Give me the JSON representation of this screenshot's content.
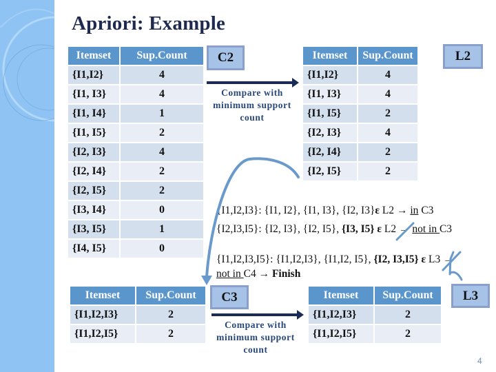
{
  "slide": {
    "title": "Apriori: Example",
    "page_number": "4"
  },
  "c2_table": {
    "headers": [
      "Itemset",
      "Sup.Count"
    ],
    "rows": [
      {
        "itemset": "{I1,I2}",
        "count": "4"
      },
      {
        "itemset": "{I1, I3}",
        "count": "4"
      },
      {
        "itemset": "{I1, I4}",
        "count": "1"
      },
      {
        "itemset": "{I1, I5}",
        "count": "2"
      },
      {
        "itemset": "{I2, I3}",
        "count": "4"
      },
      {
        "itemset": "{I2, I4}",
        "count": "2"
      },
      {
        "itemset": "{I2, I5}",
        "count": "2"
      },
      {
        "itemset": "{I3, I4}",
        "count": "0"
      },
      {
        "itemset": "{I3, I5}",
        "count": "1"
      },
      {
        "itemset": "{I4, I5}",
        "count": "0"
      }
    ]
  },
  "c2_label": "C2",
  "compare_text_1": [
    "Compare with",
    "minimum support",
    "count"
  ],
  "l2_table": {
    "headers": [
      "Itemset",
      "Sup.Count"
    ],
    "rows": [
      {
        "itemset": "{I1,I2}",
        "count": "4"
      },
      {
        "itemset": "{I1, I3}",
        "count": "4"
      },
      {
        "itemset": "{I1, I5}",
        "count": "2"
      },
      {
        "itemset": "{I2, I3}",
        "count": "4"
      },
      {
        "itemset": "{I2, I4}",
        "count": "2"
      },
      {
        "itemset": "{I2, I5}",
        "count": "2"
      }
    ]
  },
  "l2_label": "L2",
  "reasoning": {
    "line1": {
      "pre": "{I1,I2,I3}: {I1, I2}, {I1, I3}, {I2, I3}",
      "symbol": "ε",
      "mid": " L2 → ",
      "underlined": "in",
      "post": " C3"
    },
    "line2": {
      "pre": "{I2,I3,I5}: {I2, I3}, {I2, I5}, ",
      "bold": "{I3, I5}",
      "symbol": " ε",
      "mid": " L2 → ",
      "underlined": "not in ",
      "post": "C3"
    },
    "line3": {
      "pre": "{I1,I2,I3,I5}: {I1,I2,I3}, {I1,I2, I5}, ",
      "bold": "{I2, I3,I5}",
      "symbol": " ε",
      "mid": " L3 →"
    },
    "line4": {
      "underlined": "not in ",
      "mid": "C4 → ",
      "bold": "Finish"
    }
  },
  "c3_table": {
    "headers": [
      "Itemset",
      "Sup.Count"
    ],
    "rows": [
      {
        "itemset": "{I1,I2,I3}",
        "count": "2"
      },
      {
        "itemset": "{I1,I2,I5}",
        "count": "2"
      }
    ]
  },
  "c3_label": "C3",
  "compare_text_2": [
    "Compare with",
    "minimum support",
    "count"
  ],
  "l3_table": {
    "headers": [
      "Itemset",
      "Sup.Count"
    ],
    "rows": [
      {
        "itemset": "{I1,I2,I3}",
        "count": "2"
      },
      {
        "itemset": "{I1,I2,I5}",
        "count": "2"
      }
    ]
  },
  "l3_label": "L3",
  "colors": {
    "header_bg": "#5a95cc",
    "row_odd": "#d4dfee",
    "row_even": "#e9eef6",
    "tag_bg": "#a6c3e7",
    "tag_border": "#8b9fcd",
    "annotation_stroke": "#6a9acb",
    "title": "#1f2a4f"
  }
}
